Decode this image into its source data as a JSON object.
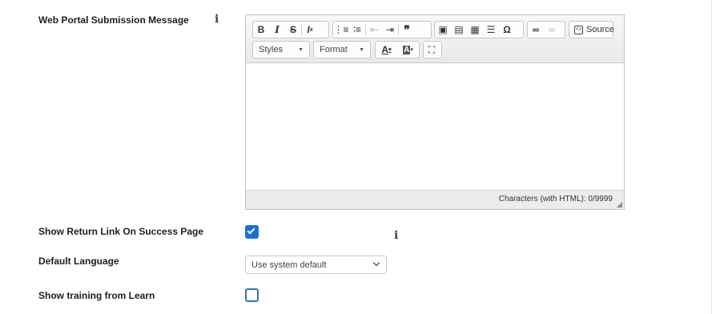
{
  "web_portal": {
    "label": "Web Portal Submission Message",
    "info_icon": "info-icon",
    "editor": {
      "toolbar_row1": [
        {
          "name": "bold",
          "glyph": "B"
        },
        {
          "name": "italic",
          "glyph": "I"
        },
        {
          "name": "strikethrough",
          "glyph": "S"
        },
        {
          "name": "remove-format",
          "glyph": "Ix"
        },
        {
          "name": "numbered-list",
          "glyph": "≡"
        },
        {
          "name": "bulleted-list",
          "glyph": "≡"
        },
        {
          "name": "decrease-indent",
          "glyph": "⇤"
        },
        {
          "name": "increase-indent",
          "glyph": "⇥"
        },
        {
          "name": "blockquote",
          "glyph": "❞"
        },
        {
          "name": "image",
          "glyph": "▣"
        },
        {
          "name": "flash",
          "glyph": "▤"
        },
        {
          "name": "table",
          "glyph": "▦"
        },
        {
          "name": "horizontal-line",
          "glyph": "☰"
        },
        {
          "name": "special-char",
          "glyph": "Ω"
        },
        {
          "name": "link",
          "glyph": "∞"
        },
        {
          "name": "unlink",
          "glyph": "∞"
        }
      ],
      "source_label": "Source",
      "styles_label": "Styles",
      "format_label": "Format",
      "text_color_glyph": "A",
      "bg_color_glyph": "A",
      "maximize_glyph": "⛶",
      "char_count": "Characters (with HTML): 0/9999"
    }
  },
  "return_link": {
    "label": "Show Return Link On Success Page",
    "checked": true,
    "info_icon": "info-icon"
  },
  "default_language": {
    "label": "Default Language",
    "selected": "Use system default"
  },
  "training": {
    "label": "Show training from Learn",
    "checked": false
  },
  "colors": {
    "accent": "#1a72d8",
    "toolbar_bg": "#ececec"
  }
}
